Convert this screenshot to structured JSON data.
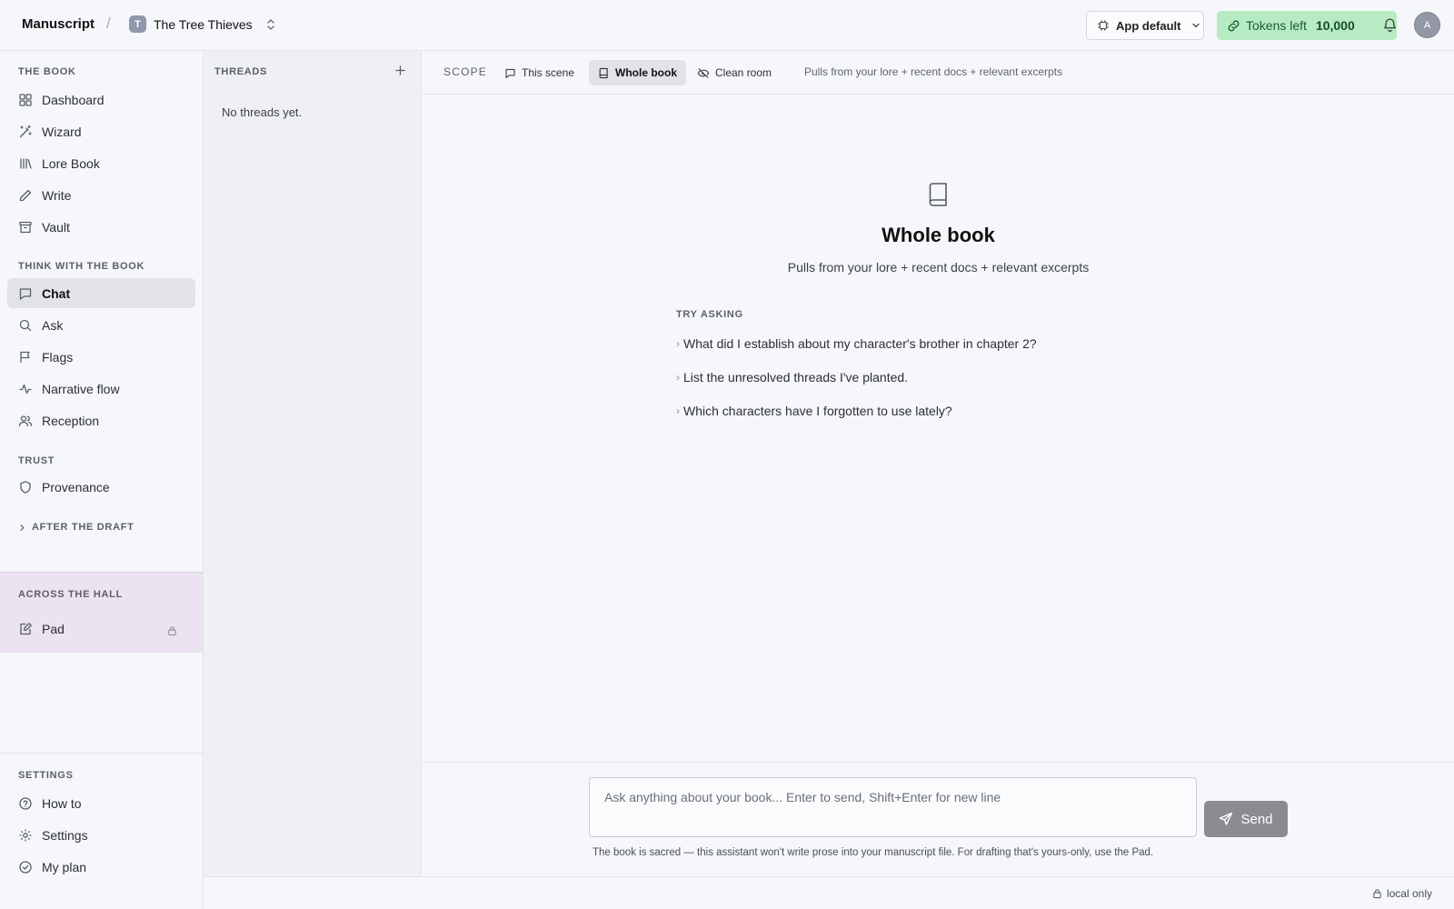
{
  "header": {
    "brand": "Manuscript",
    "separator": "/",
    "project_initial": "T",
    "project_name": "The Tree Thieves",
    "model_label": "App default",
    "tokens_label": "Tokens left",
    "tokens_value": "10,000",
    "user_initial": "A"
  },
  "sidebar": {
    "sections": {
      "book": "THE BOOK",
      "think": "THINK WITH THE BOOK",
      "trust": "TRUST",
      "after_draft": "AFTER THE DRAFT",
      "hall": "ACROSS THE HALL",
      "settings": "SETTINGS"
    },
    "book_items": [
      {
        "label": "Dashboard",
        "icon": "dashboard-icon"
      },
      {
        "label": "Wizard",
        "icon": "wand-icon"
      },
      {
        "label": "Lore Book",
        "icon": "library-icon"
      },
      {
        "label": "Write",
        "icon": "pencil-icon"
      },
      {
        "label": "Vault",
        "icon": "archive-icon"
      }
    ],
    "think_items": [
      {
        "label": "Chat",
        "icon": "chat-icon",
        "active": true
      },
      {
        "label": "Ask",
        "icon": "search-icon"
      },
      {
        "label": "Flags",
        "icon": "flag-icon"
      },
      {
        "label": "Narrative flow",
        "icon": "activity-icon"
      },
      {
        "label": "Reception",
        "icon": "users-icon"
      }
    ],
    "trust_items": [
      {
        "label": "Provenance",
        "icon": "shield-icon"
      }
    ],
    "hall_items": [
      {
        "label": "Pad",
        "icon": "notepad-icon",
        "locked": true
      }
    ],
    "settings_items": [
      {
        "label": "How to",
        "icon": "help-icon"
      },
      {
        "label": "Settings",
        "icon": "gear-icon"
      },
      {
        "label": "My plan",
        "icon": "check-circle-icon"
      }
    ]
  },
  "threads": {
    "title": "THREADS",
    "empty": "No threads yet."
  },
  "scope": {
    "label": "SCOPE",
    "tabs": [
      {
        "label": "This scene",
        "icon": "chat-icon"
      },
      {
        "label": "Whole book",
        "icon": "book-icon",
        "active": true
      },
      {
        "label": "Clean room",
        "icon": "eye-off-icon"
      }
    ],
    "description": "Pulls from your lore + recent docs + relevant excerpts"
  },
  "hero": {
    "title": "Whole book",
    "description": "Pulls from your lore + recent docs + relevant excerpts",
    "try_label": "TRY ASKING",
    "suggestions": [
      "What did I establish about my character's brother in chapter 2?",
      "List the unresolved threads I've planted.",
      "Which characters have I forgotten to use lately?"
    ]
  },
  "composer": {
    "placeholder": "Ask anything about your book... Enter to send, Shift+Enter for new line",
    "send_label": "Send",
    "note": "The book is sacred — this assistant won't write prose into your manuscript file. For drafting that's yours-only, use the Pad."
  },
  "footer": {
    "status": "local only"
  },
  "colors": {
    "tokens_bg": "#b6ebc3",
    "tokens_text": "#1a5e30",
    "hall_bg": "#ece3f2",
    "active_bg": "#e2e3e7",
    "send_bg": "#8a8c90"
  }
}
